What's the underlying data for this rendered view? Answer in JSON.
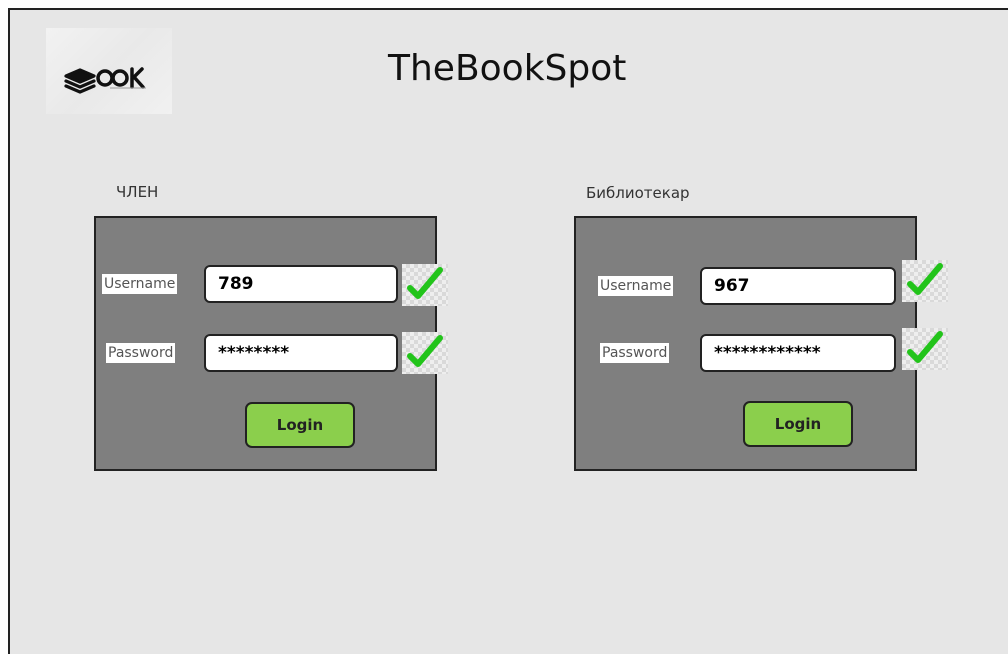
{
  "app": {
    "title": "TheBookSpot",
    "logo_text": "ƆƆK"
  },
  "member": {
    "section_label": "ЧЛЕН",
    "username_label": "Username",
    "username_value": "789",
    "password_label": "Password",
    "password_value": "********",
    "login_label": "Login"
  },
  "librarian": {
    "section_label": "Библиотекар",
    "username_label": "Username",
    "username_value": "967",
    "password_label": "Password",
    "password_value": "************",
    "login_label": "Login"
  },
  "colors": {
    "background": "#e6e6e6",
    "panel": "#7f7f7f",
    "button": "#8bcf4c",
    "check": "#22c41a"
  },
  "icons": {
    "logo": "book-stack-logo",
    "valid": "checkmark-icon"
  }
}
